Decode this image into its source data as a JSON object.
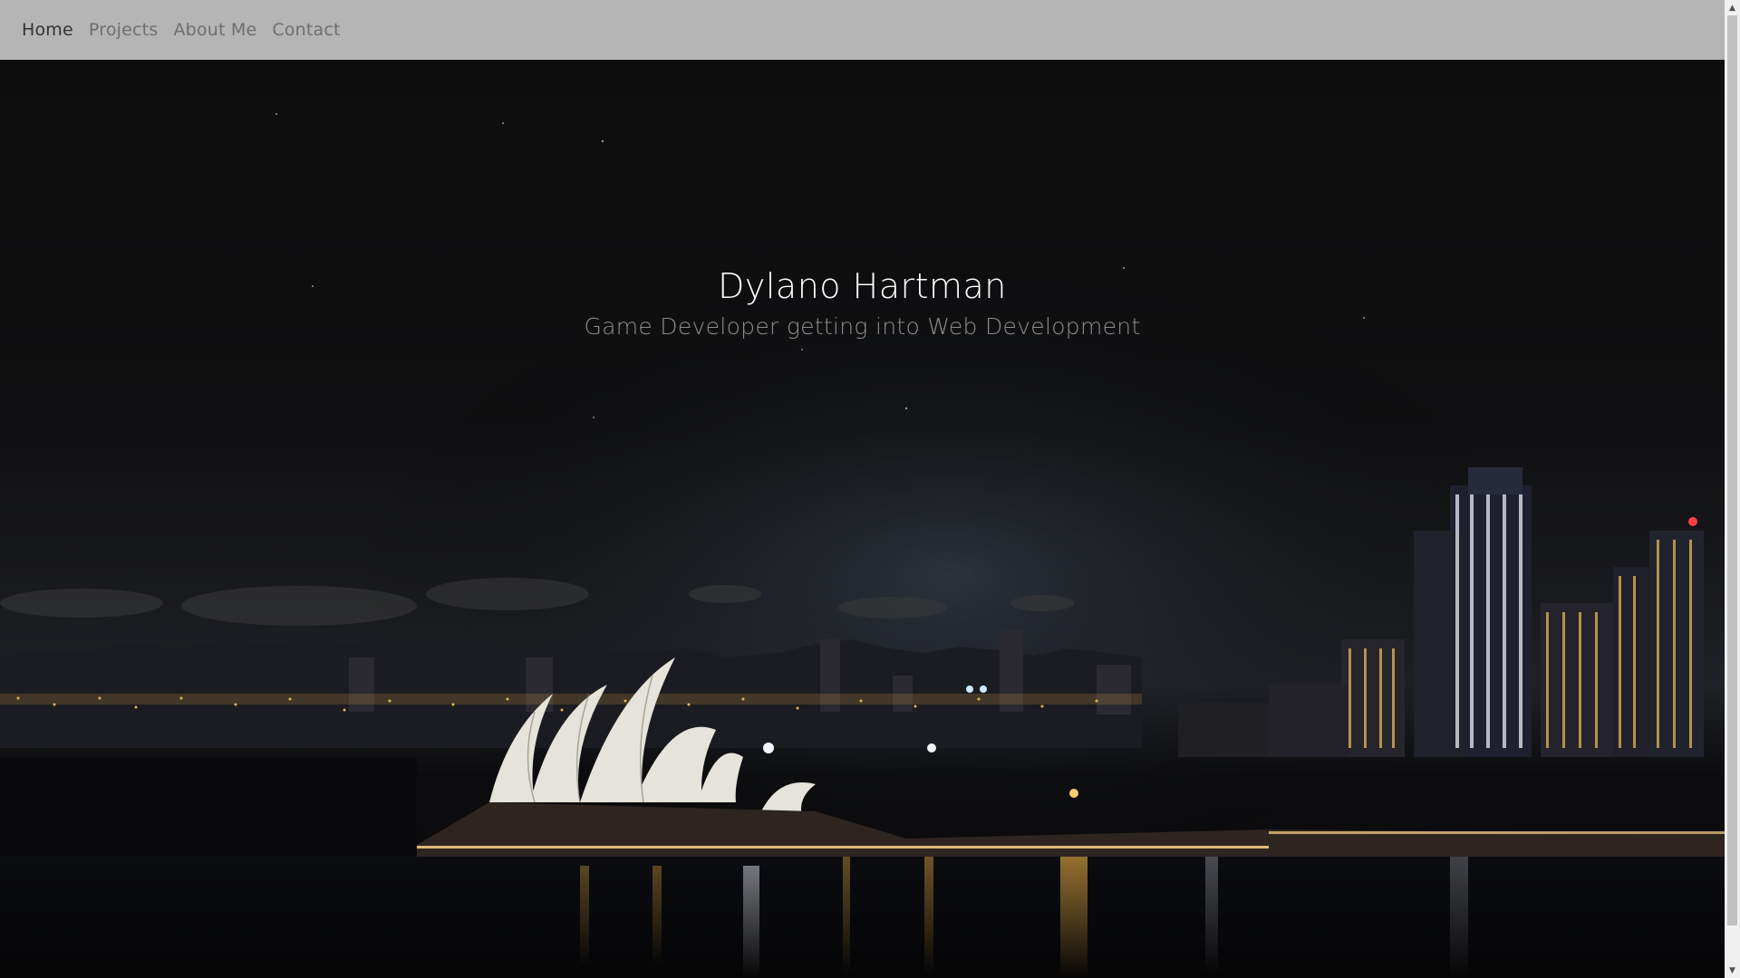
{
  "nav": {
    "items": [
      {
        "label": "Home",
        "active": true
      },
      {
        "label": "Projects",
        "active": false
      },
      {
        "label": "About Me",
        "active": false
      },
      {
        "label": "Contact",
        "active": false
      }
    ]
  },
  "hero": {
    "title": "Dylano Hartman",
    "subtitle": "Game Developer getting into Web Development",
    "background": "night-city-skyline-harbor-image"
  },
  "colors": {
    "navbar_bg": "#b5b5b5",
    "nav_active": "#333333",
    "nav_inactive": "#6e6e6e",
    "hero_title": "#ffffff",
    "hero_subtitle": "#8e8e8e"
  },
  "scrollbar": {
    "up_icon": "chevron-up-icon",
    "down_icon": "chevron-down-icon"
  }
}
